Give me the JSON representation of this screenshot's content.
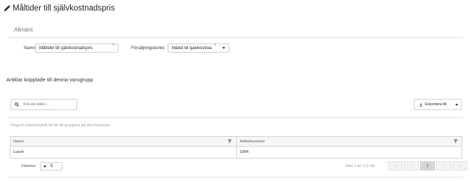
{
  "header": {
    "title": "Måltider till självkostnadspris",
    "icon": "pencil-icon"
  },
  "general": {
    "section_title": "Allmänt",
    "name_label": "Namn:",
    "name_value": "Måltider till självkostnadspris",
    "sales_account_label": "Försäljningskonto:",
    "sales_account_value": "Måltid till självkostnadspris",
    "required_marker": "*"
  },
  "articles": {
    "heading": "Artiklar kopplade till denna varugrupp",
    "search_placeholder": "Sök på sidan...",
    "export_label": "Exportera till",
    "group_hint": "Drag en kolumnrubrik hit för att gruppera på den kolumnen",
    "columns": [
      "Namn",
      "Artikelnummer"
    ],
    "rows": [
      [
        "Lunch",
        "1004"
      ]
    ],
    "page_size_label": "Sidantal:",
    "page_size_value": "5",
    "page_info": "Sida 1 av 1 (1 st)",
    "pager": {
      "first": "«",
      "prev": "‹",
      "current": "1",
      "next": "›",
      "last": "»"
    }
  },
  "colors": {
    "required": "#e23b3b",
    "border": "#d0d0d0"
  }
}
